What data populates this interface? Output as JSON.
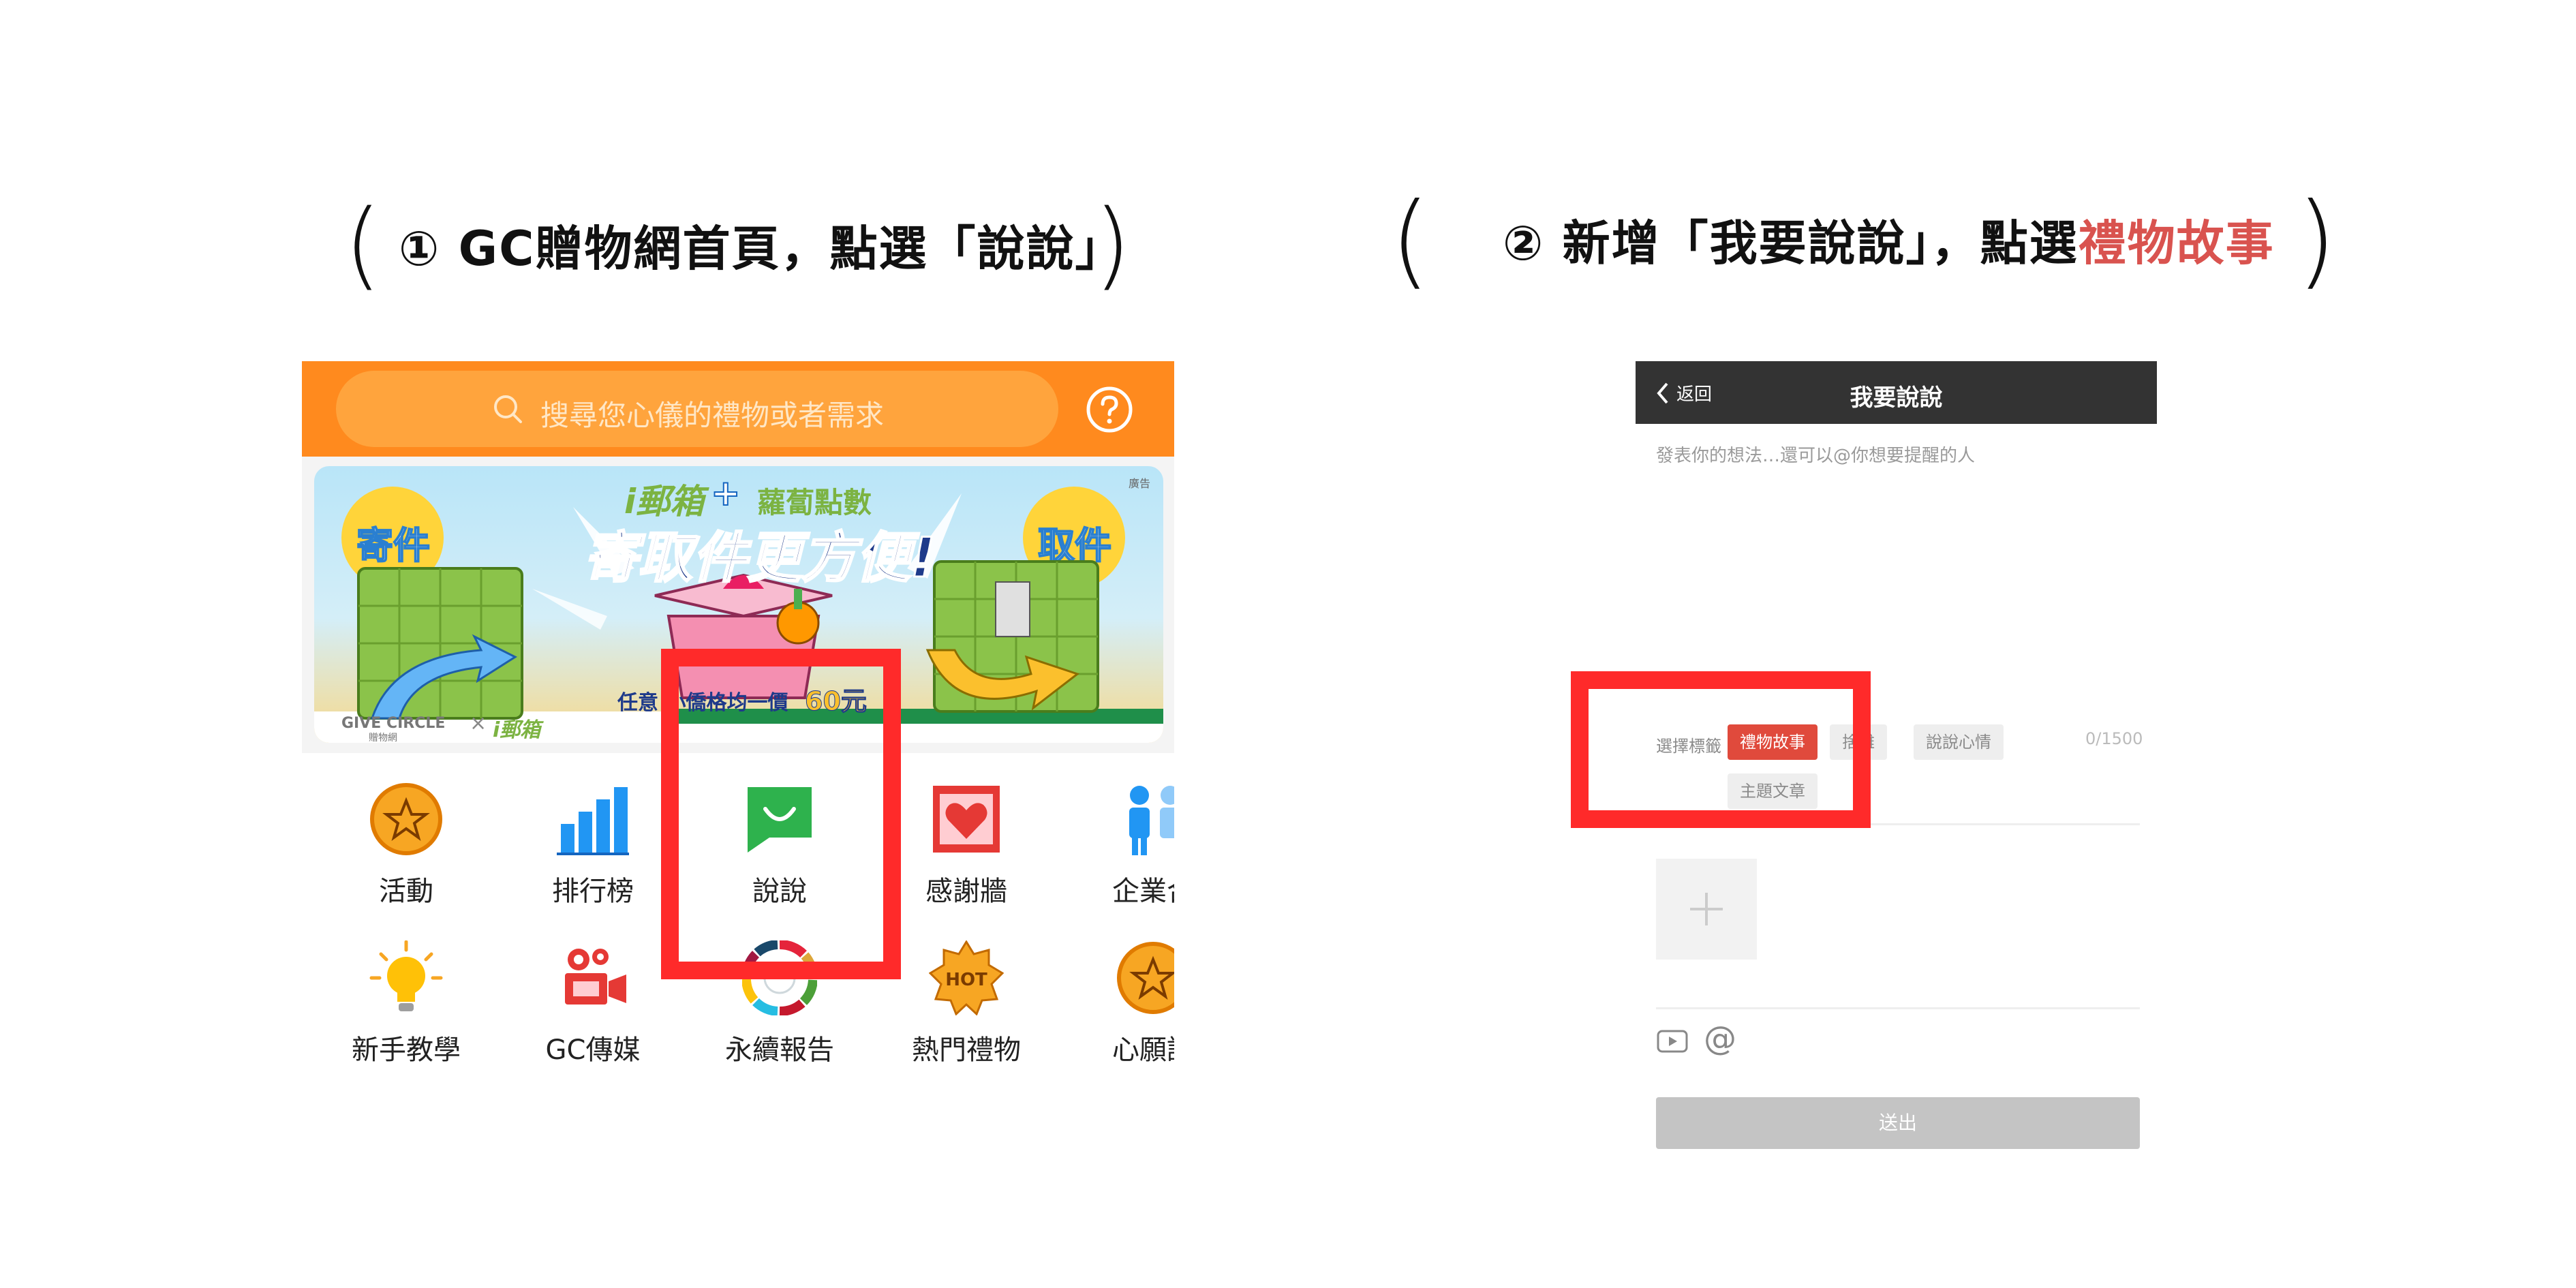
{
  "headings": {
    "step1": "① GC贈物網首頁，點選「說說」",
    "step2_main": "② 新增「我要說說」，點選",
    "step2_accent": "禮物故事",
    "paren_open": "(",
    "paren_close": ")"
  },
  "colors": {
    "brand_orange": "#ff8a1e",
    "highlight_red": "#ff2a2a",
    "accent_red": "#d9534f",
    "tag_active": "#e04a3c",
    "nav_dark": "#333333"
  },
  "home": {
    "search_placeholder": "搜尋您心儀的禮物或者需求",
    "banner": {
      "ad_label": "廣告",
      "top_line_brand": "i郵箱",
      "plus": "+",
      "top_line_points": "蘿蔔點數",
      "headline": "寄取件更方便!",
      "badge_left": "寄件",
      "badge_right": "取件",
      "price_prefix": "任意 小僑格均一價",
      "price_value": "60元",
      "footer_brand": "GIVE CIRCLE",
      "footer_brand_sub": "贈物網",
      "footer_x": "×",
      "footer_partner": "i郵箱"
    },
    "categories_row1": [
      {
        "label": "活動",
        "icon": "star-coin-icon"
      },
      {
        "label": "排行榜",
        "icon": "bar-chart-icon"
      },
      {
        "label": "說說",
        "icon": "speech-bubble-icon"
      },
      {
        "label": "感謝牆",
        "icon": "heart-frame-icon"
      },
      {
        "label": "企業合",
        "icon": "people-icon"
      }
    ],
    "categories_row2": [
      {
        "label": "新手教學",
        "icon": "lightbulb-icon"
      },
      {
        "label": "GC傳媒",
        "icon": "video-camera-icon"
      },
      {
        "label": "永續報告",
        "icon": "sdg-ring-icon"
      },
      {
        "label": "熱門禮物",
        "icon": "hot-badge-icon"
      },
      {
        "label": "心願認",
        "icon": "star-coin-icon"
      }
    ]
  },
  "compose": {
    "back_label": "返回",
    "title": "我要說說",
    "placeholder": "發表你的想法…還可以@你想要提醒的人",
    "tag_label": "選擇標籤",
    "tags": [
      "禮物故事",
      "捨離",
      "說說心情",
      "主題文章"
    ],
    "counter": "0/1500",
    "mention_symbol": "@",
    "submit_label": "送出"
  }
}
